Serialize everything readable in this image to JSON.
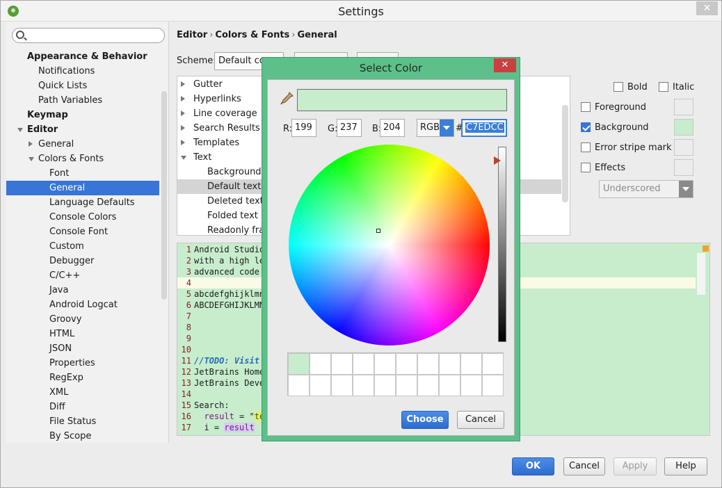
{
  "window": {
    "title": "Settings"
  },
  "sidebar": {
    "search_placeholder": "",
    "items": [
      {
        "label": "Appearance & Behavior",
        "bold": true,
        "indent": 0
      },
      {
        "label": "Notifications",
        "indent": 2
      },
      {
        "label": "Quick Lists",
        "indent": 2
      },
      {
        "label": "Path Variables",
        "indent": 2
      },
      {
        "label": "Keymap",
        "bold": true,
        "indent": 0
      },
      {
        "label": "Editor",
        "bold": true,
        "indent": 0,
        "expanded": true
      },
      {
        "label": "General",
        "indent": 1,
        "collapsed": true
      },
      {
        "label": "Colors & Fonts",
        "indent": 1,
        "expanded": true
      },
      {
        "label": "Font",
        "indent": 3
      },
      {
        "label": "General",
        "indent": 3,
        "selected": true
      },
      {
        "label": "Language Defaults",
        "indent": 3
      },
      {
        "label": "Console Colors",
        "indent": 3
      },
      {
        "label": "Console Font",
        "indent": 3
      },
      {
        "label": "Custom",
        "indent": 3
      },
      {
        "label": "Debugger",
        "indent": 3
      },
      {
        "label": "C/C++",
        "indent": 3
      },
      {
        "label": "Java",
        "indent": 3
      },
      {
        "label": "Android Logcat",
        "indent": 3
      },
      {
        "label": "Groovy",
        "indent": 3
      },
      {
        "label": "HTML",
        "indent": 3
      },
      {
        "label": "JSON",
        "indent": 3
      },
      {
        "label": "Properties",
        "indent": 3
      },
      {
        "label": "RegExp",
        "indent": 3
      },
      {
        "label": "XML",
        "indent": 3
      },
      {
        "label": "Diff",
        "indent": 3
      },
      {
        "label": "File Status",
        "indent": 3
      },
      {
        "label": "By Scope",
        "indent": 3
      }
    ]
  },
  "breadcrumb": [
    "Editor",
    "Colors & Fonts",
    "General"
  ],
  "scheme": {
    "label": "Scheme:",
    "value": "Default cop"
  },
  "categories": [
    {
      "label": "Gutter",
      "arrow": "right"
    },
    {
      "label": "Hyperlinks",
      "arrow": "right"
    },
    {
      "label": "Line coverage",
      "arrow": "right"
    },
    {
      "label": "Search Results",
      "arrow": "right"
    },
    {
      "label": "Templates",
      "arrow": "right"
    },
    {
      "label": "Text",
      "arrow": "down"
    },
    {
      "label": "Background i",
      "child": true
    },
    {
      "label": "Default text",
      "child": true,
      "selected": true
    },
    {
      "label": "Deleted text",
      "child": true
    },
    {
      "label": "Folded text",
      "child": true
    },
    {
      "label": "Readonly frag",
      "child": true
    }
  ],
  "options": {
    "bold": "Bold",
    "italic": "Italic",
    "foreground": "Foreground",
    "background": "Background",
    "error_stripe": "Error stripe mark",
    "effects": "Effects",
    "effect_type": "Underscored",
    "background_color": "#c7edcc"
  },
  "editor": {
    "lines": [
      {
        "n": "1",
        "text": "Android Studio"
      },
      {
        "n": "2",
        "text": "with a high le"
      },
      {
        "n": "3",
        "text": "advanced code "
      },
      {
        "n": "4",
        "text": "",
        "caret": true
      },
      {
        "n": "5",
        "text": "abcdefghijklmn"
      },
      {
        "n": "6",
        "text": "ABCDEFGHIJKLMN"
      },
      {
        "n": "7",
        "text": ""
      },
      {
        "n": "8",
        "text": ""
      },
      {
        "n": "9",
        "text": ""
      },
      {
        "n": "10",
        "text": ""
      },
      {
        "n": "11",
        "todo": "//TODO: Visit "
      },
      {
        "n": "12",
        "text": "JetBrains Home"
      },
      {
        "n": "13",
        "text": "JetBrains Deve"
      },
      {
        "n": "14",
        "text": ""
      },
      {
        "n": "15",
        "text": "Search:"
      },
      {
        "n": "16",
        "indent": "  ",
        "var": "result",
        "mid": " = \"",
        "str": "te"
      },
      {
        "n": "17",
        "indent": "  ",
        "plain": "i = ",
        "sel": "result"
      }
    ]
  },
  "footer": {
    "ok": "OK",
    "cancel": "Cancel",
    "apply": "Apply",
    "help": "Help"
  },
  "color_dialog": {
    "title": "Select Color",
    "close": "✕",
    "r_label": "R:",
    "r": "199",
    "g_label": "G:",
    "g": "237",
    "b_label": "B:",
    "b": "204",
    "mode": "RGB",
    "hash": "#",
    "hex": "C7EDCC",
    "preview_color": "#c7edcc",
    "recent_colors": [
      "#c7edcc"
    ],
    "choose": "Choose",
    "cancel": "Cancel"
  }
}
